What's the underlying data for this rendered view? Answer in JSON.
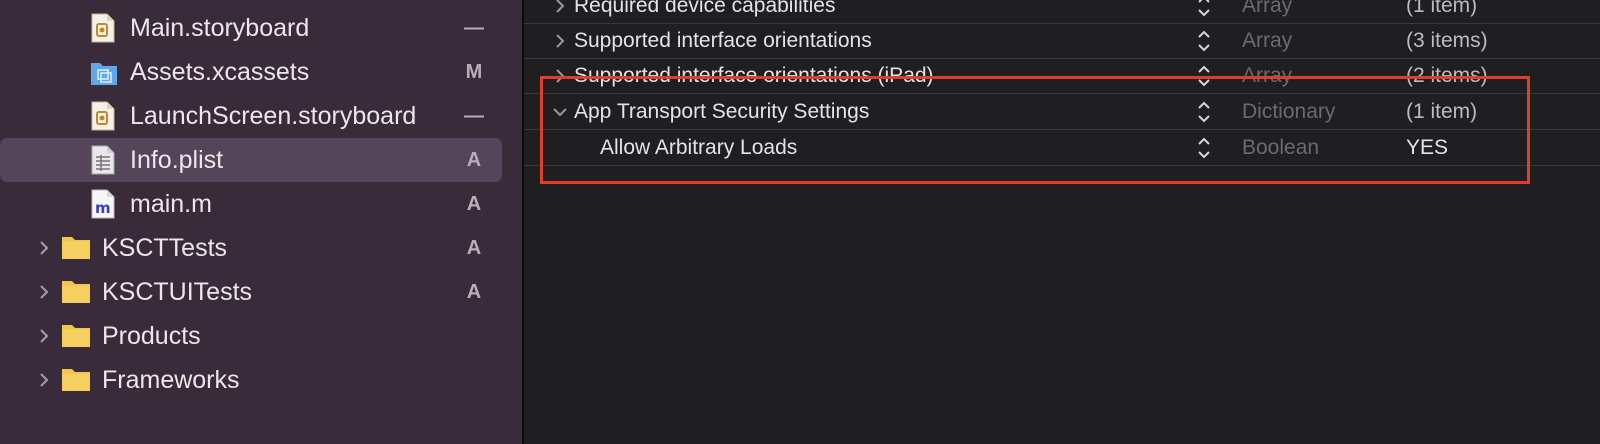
{
  "navigator": {
    "files": [
      {
        "name": "Main.storyboard",
        "status": "—",
        "icon": "storyboard-icon"
      },
      {
        "name": "Assets.xcassets",
        "status": "M",
        "icon": "assets-folder-icon"
      },
      {
        "name": "LaunchScreen.storyboard",
        "status": "—",
        "icon": "storyboard-icon"
      },
      {
        "name": "Info.plist",
        "status": "A",
        "icon": "plist-file-icon",
        "selected": true
      },
      {
        "name": "main.m",
        "status": "A",
        "icon": "objc-file-icon"
      }
    ],
    "groups": [
      {
        "name": "KSCTTests",
        "status": "A",
        "icon": "folder-icon"
      },
      {
        "name": "KSCTUITests",
        "status": "A",
        "icon": "folder-icon"
      },
      {
        "name": "Products",
        "status": "",
        "icon": "folder-icon"
      },
      {
        "name": "Frameworks",
        "status": "",
        "icon": "folder-icon"
      }
    ]
  },
  "plist": {
    "rows": [
      {
        "key": "Required device capabilities",
        "type": "Array",
        "value": "(1 item)"
      },
      {
        "key": "Supported interface orientations",
        "type": "Array",
        "value": "(3 items)"
      },
      {
        "key": "Supported interface orientations (iPad)",
        "type": "Array",
        "value": "(2 items)"
      },
      {
        "key": "App Transport Security Settings",
        "type": "Dictionary",
        "value": "(1 item)",
        "expanded": true
      },
      {
        "key": "Allow Arbitrary Loads",
        "type": "Boolean",
        "value": "YES",
        "child": true
      }
    ]
  },
  "colors": {
    "navigator_bg": "#3a2b3a",
    "selection_bg": "#54455a",
    "editor_bg": "#1f1e21",
    "highlight": "#e23c2b",
    "folder": "#f3c74e"
  }
}
